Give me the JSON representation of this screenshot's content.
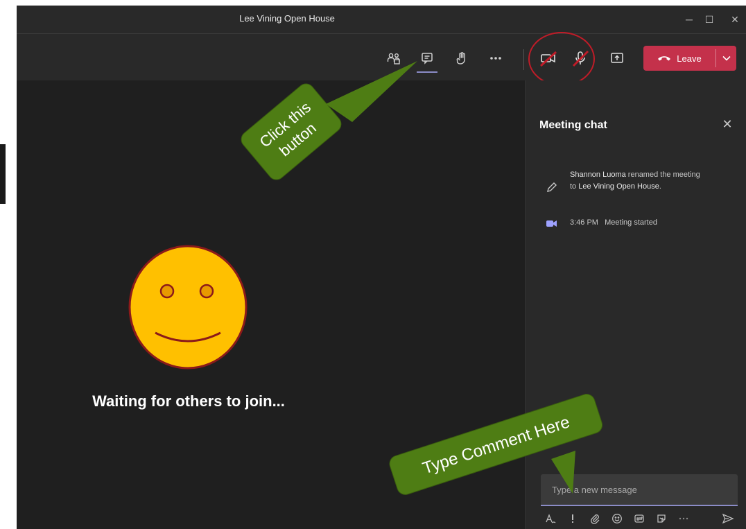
{
  "window": {
    "title": "Lee Vining Open House",
    "controls": [
      "─",
      "☐",
      "✕"
    ]
  },
  "toolbar": {
    "leave_label": "Leave"
  },
  "stage": {
    "waiting_text": "Waiting for others to join..."
  },
  "chat": {
    "title": "Meeting chat",
    "close_glyph": "✕",
    "messages": [
      {
        "icon": "pencil-icon",
        "actor": "Shannon Luoma",
        "action": " renamed the meeting to ",
        "target": "Lee Vining Open House",
        "end": "."
      },
      {
        "icon": "meeting-video-icon",
        "time": "3:46 PM",
        "text": "Meeting started"
      }
    ],
    "composer_placeholder": "Type a new message"
  },
  "annotations": {
    "click_callout_line1": "Click this",
    "click_callout_line2": "button",
    "type_callout": "Type Comment Here"
  },
  "colors": {
    "leave_red": "#c4314b",
    "accent_purple": "#8b8cc7",
    "callout_green": "#4e7d14",
    "smiley_yellow": "#ffc000",
    "smiley_outline": "#8b1a1a"
  }
}
